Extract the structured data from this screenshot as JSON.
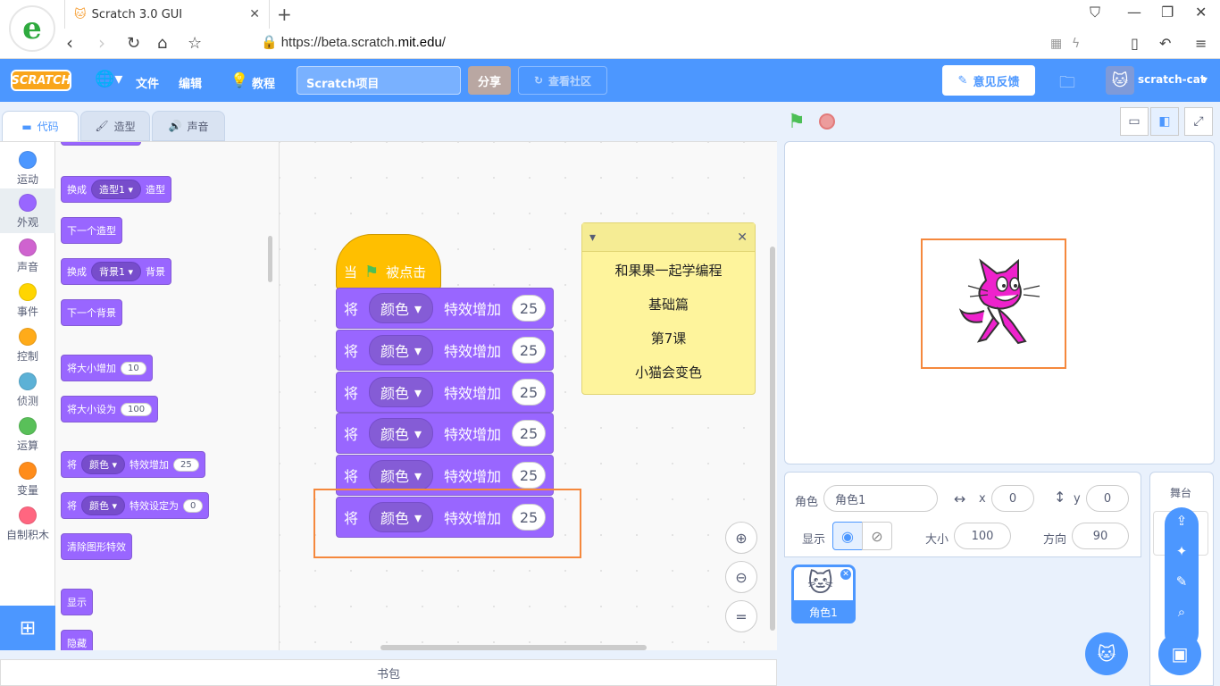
{
  "browser": {
    "tab_title": "Scratch 3.0 GUI",
    "url_prefix": "https://beta.scratch.",
    "url_domain": "mit.edu",
    "url_suffix": "/"
  },
  "menubar": {
    "logo": "SCRATCH",
    "file": "文件",
    "edit": "编辑",
    "tutorials": "教程",
    "project_title": "Scratch项目",
    "share": "分享",
    "see_community": "查看社区",
    "feedback": "意见反馈",
    "username": "scratch-cat",
    "colors": {
      "bar": "#4c97ff",
      "logo": "#f9a51b"
    }
  },
  "editor_tabs": {
    "code": "代码",
    "costumes": "造型",
    "sounds": "声音"
  },
  "categories": [
    {
      "label": "运动",
      "color": "#4c97ff"
    },
    {
      "label": "外观",
      "color": "#9966ff"
    },
    {
      "label": "声音",
      "color": "#cf63cf"
    },
    {
      "label": "事件",
      "color": "#ffd500"
    },
    {
      "label": "控制",
      "color": "#ffab19"
    },
    {
      "label": "侦测",
      "color": "#5cb1d6"
    },
    {
      "label": "运算",
      "color": "#59c059"
    },
    {
      "label": "变量",
      "color": "#ff8c1a"
    },
    {
      "label": "自制积木",
      "color": "#ff6680"
    }
  ],
  "palette": {
    "switch_costume": {
      "prefix": "换成",
      "value": "造型1",
      "suffix": "造型"
    },
    "next_costume": "下一个造型",
    "switch_backdrop": {
      "prefix": "换成",
      "value": "背景1",
      "suffix": "背景"
    },
    "next_backdrop": "下一个背景",
    "change_size": {
      "label": "将大小增加",
      "value": "10"
    },
    "set_size": {
      "label": "将大小设为",
      "value": "100"
    },
    "change_effect": {
      "prefix": "将",
      "value": "颜色",
      "suffix": "特效增加",
      "num": "25"
    },
    "set_effect": {
      "prefix": "将",
      "value": "颜色",
      "suffix": "特效设定为",
      "num": "0"
    },
    "clear_effects": "清除图形特效",
    "show": "显示",
    "hide": "隐藏"
  },
  "script": {
    "hat": {
      "prefix": "当",
      "suffix": "被点击"
    },
    "blocks": [
      {
        "prefix": "将",
        "effect": "颜色",
        "suffix": "特效增加",
        "value": "25"
      },
      {
        "prefix": "将",
        "effect": "颜色",
        "suffix": "特效增加",
        "value": "25"
      },
      {
        "prefix": "将",
        "effect": "颜色",
        "suffix": "特效增加",
        "value": "25"
      },
      {
        "prefix": "将",
        "effect": "颜色",
        "suffix": "特效增加",
        "value": "25"
      },
      {
        "prefix": "将",
        "effect": "颜色",
        "suffix": "特效增加",
        "value": "25"
      },
      {
        "prefix": "将",
        "effect": "颜色",
        "suffix": "特效增加",
        "value": "25"
      }
    ]
  },
  "note": {
    "lines": [
      "和果果一起学编程",
      "基础篇",
      "第7课",
      "小猫会变色"
    ]
  },
  "zoom": {
    "reset": "="
  },
  "backpack": "书包",
  "sprite_info": {
    "sprite_label": "角色",
    "sprite_name": "角色1",
    "x_label": "x",
    "x_value": "0",
    "y_label": "y",
    "y_value": "0",
    "show_label": "显示",
    "size_label": "大小",
    "size_value": "100",
    "direction_label": "方向",
    "direction_value": "90"
  },
  "sprite_list": [
    {
      "name": "角色1"
    }
  ],
  "stage_panel": {
    "label": "舞台"
  },
  "highlight_color": "#f5883d"
}
